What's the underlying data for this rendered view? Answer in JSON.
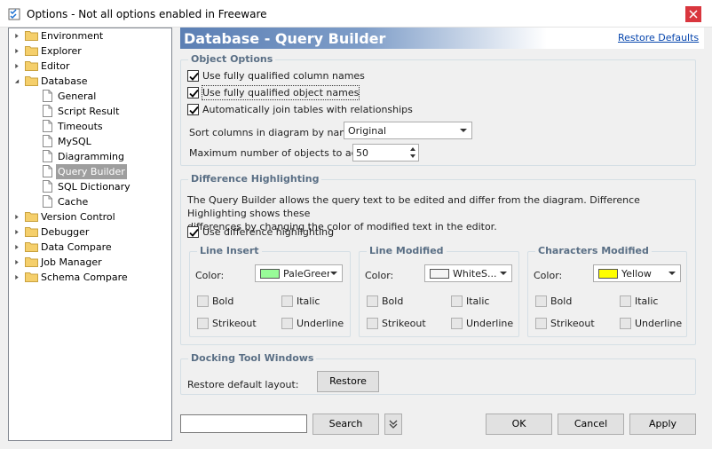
{
  "window": {
    "title": "Options - Not all options enabled in Freeware"
  },
  "tree": {
    "items": [
      {
        "label": "Environment",
        "kind": "folder",
        "level": 0,
        "expanded": false
      },
      {
        "label": "Explorer",
        "kind": "folder",
        "level": 0,
        "expanded": false
      },
      {
        "label": "Editor",
        "kind": "folder",
        "level": 0,
        "expanded": false
      },
      {
        "label": "Database",
        "kind": "folder",
        "level": 0,
        "expanded": true
      },
      {
        "label": "General",
        "kind": "page",
        "level": 1
      },
      {
        "label": "Script Result",
        "kind": "page",
        "level": 1
      },
      {
        "label": "Timeouts",
        "kind": "page",
        "level": 1
      },
      {
        "label": "MySQL",
        "kind": "page",
        "level": 1
      },
      {
        "label": "Diagramming",
        "kind": "page",
        "level": 1
      },
      {
        "label": "Query Builder",
        "kind": "page",
        "level": 1,
        "selected": true
      },
      {
        "label": "SQL Dictionary",
        "kind": "page",
        "level": 1
      },
      {
        "label": "Cache",
        "kind": "page",
        "level": 1
      },
      {
        "label": "Version Control",
        "kind": "folder",
        "level": 0,
        "expanded": false
      },
      {
        "label": "Debugger",
        "kind": "folder",
        "level": 0,
        "expanded": false
      },
      {
        "label": "Data Compare",
        "kind": "folder",
        "level": 0,
        "expanded": false
      },
      {
        "label": "Job Manager",
        "kind": "folder",
        "level": 0,
        "expanded": false
      },
      {
        "label": "Schema Compare",
        "kind": "folder",
        "level": 0,
        "expanded": false
      }
    ]
  },
  "header": {
    "title": "Database - Query Builder",
    "restore_link": "Restore Defaults"
  },
  "object_options": {
    "legend": "Object Options",
    "checkboxes": [
      {
        "label": "Use fully qualified column names",
        "checked": true
      },
      {
        "label": "Use fully qualified object names",
        "checked": true
      },
      {
        "label": "Automatically join tables with relationships",
        "checked": true
      }
    ],
    "sort_label": "Sort columns in diagram by name:",
    "sort_value": "Original",
    "max_label": "Maximum number of objects to add:",
    "max_value": "50"
  },
  "difference": {
    "legend": "Difference Highlighting",
    "description_line1": "The Query Builder allows the query text to be edited and differ from the diagram. Difference Highlighting shows these",
    "description_line2": "differences by changing the color of modified text in the editor.",
    "use_label": "Use difference highlighting",
    "use_checked": true,
    "color_label": "Color:",
    "bold": "Bold",
    "italic": "Italic",
    "strikeout": "Strikeout",
    "underline": "Underline",
    "panels": [
      {
        "legend": "Line Insert",
        "color_name": "PaleGreen",
        "color_hex": "#98fb98"
      },
      {
        "legend": "Line Modified",
        "color_name": "WhiteS...",
        "color_hex": "#f5f5f5"
      },
      {
        "legend": "Characters Modified",
        "color_name": "Yellow",
        "color_hex": "#ffff00"
      }
    ]
  },
  "docking": {
    "legend": "Docking Tool Windows",
    "restore_label": "Restore default layout:",
    "restore_button": "Restore"
  },
  "footer": {
    "search_button": "Search",
    "ok": "OK",
    "cancel": "Cancel",
    "apply": "Apply"
  },
  "colors": {
    "header_gradient_start": "#5b7fb4",
    "link": "#0645ad",
    "selection": "#9e9e9e",
    "close_button": "#d9363e"
  }
}
